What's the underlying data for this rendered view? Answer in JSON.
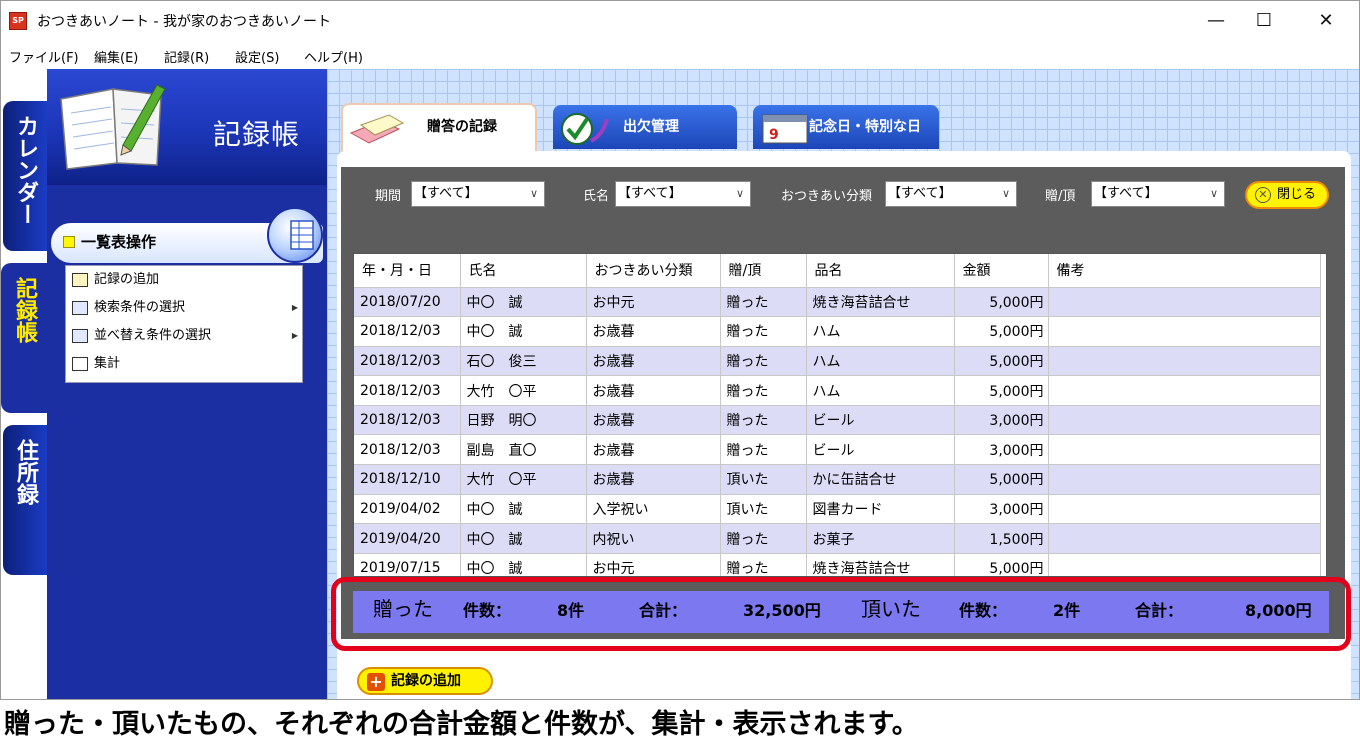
{
  "window": {
    "title": "おつきあいノート - 我が家のおつきあいノート",
    "icon_label": "SP",
    "minimize": "—",
    "maximize": "☐",
    "close": "✕"
  },
  "menu": [
    "ファイル(F)",
    "編集(E)",
    "記録(R)",
    "設定(S)",
    "ヘルプ(H)"
  ],
  "side_tabs": {
    "calendar": "カレンダー",
    "record": "記録帳",
    "address": "住所録"
  },
  "header": {
    "title": "記録帳"
  },
  "ops": {
    "title": "一覧表操作",
    "items": [
      {
        "label": "記録の追加",
        "submenu": false
      },
      {
        "label": "検索条件の選択",
        "submenu": true
      },
      {
        "label": "並べ替え条件の選択",
        "submenu": true
      },
      {
        "label": "集計",
        "submenu": false
      }
    ]
  },
  "tabs": [
    {
      "label": "贈答の記録",
      "active": true
    },
    {
      "label": "出欠管理",
      "active": false
    },
    {
      "label": "記念日・特別な日",
      "active": false
    }
  ],
  "filters": {
    "period_label": "期間",
    "period_value": "【すべて】",
    "name_label": "氏名",
    "name_value": "【すべて】",
    "category_label": "おつきあい分類",
    "category_value": "【すべて】",
    "direction_label": "贈/頂",
    "direction_value": "【すべて】",
    "close_label": "閉じる"
  },
  "table": {
    "headers": [
      "年・月・日",
      "氏名",
      "おつきあい分類",
      "贈/頂",
      "品名",
      "金額",
      "備考"
    ],
    "rows": [
      [
        "2018/07/20",
        "中〇　誠",
        "お中元",
        "贈った",
        "焼き海苔詰合せ",
        "5,000円",
        ""
      ],
      [
        "2018/12/03",
        "中〇　誠",
        "お歳暮",
        "贈った",
        "ハム",
        "5,000円",
        ""
      ],
      [
        "2018/12/03",
        "石〇　俊三",
        "お歳暮",
        "贈った",
        "ハム",
        "5,000円",
        ""
      ],
      [
        "2018/12/03",
        "大竹　〇平",
        "お歳暮",
        "贈った",
        "ハム",
        "5,000円",
        ""
      ],
      [
        "2018/12/03",
        "日野　明〇",
        "お歳暮",
        "贈った",
        "ビール",
        "3,000円",
        ""
      ],
      [
        "2018/12/03",
        "副島　直〇",
        "お歳暮",
        "贈った",
        "ビール",
        "3,000円",
        ""
      ],
      [
        "2018/12/10",
        "大竹　〇平",
        "お歳暮",
        "頂いた",
        "かに缶詰合せ",
        "5,000円",
        ""
      ],
      [
        "2019/04/02",
        "中〇　誠",
        "入学祝い",
        "頂いた",
        "図書カード",
        "3,000円",
        ""
      ],
      [
        "2019/04/20",
        "中〇　誠",
        "内祝い",
        "贈った",
        "お菓子",
        "1,500円",
        ""
      ],
      [
        "2019/07/15",
        "中〇　誠",
        "お中元",
        "贈った",
        "焼き海苔詰合せ",
        "5,000円",
        ""
      ]
    ]
  },
  "summary": {
    "gave_label": "贈った",
    "gave_count_label": "件数：",
    "gave_count": "8件",
    "gave_total_label": "合計：",
    "gave_total": "32,500円",
    "received_label": "頂いた",
    "received_count_label": "件数：",
    "received_count": "2件",
    "received_total_label": "合計：",
    "received_total": "8,000円"
  },
  "add_button": "記録の追加",
  "caption": "贈った・頂いたもの、それぞれの合計金額と件数が、集計・表示されます。"
}
